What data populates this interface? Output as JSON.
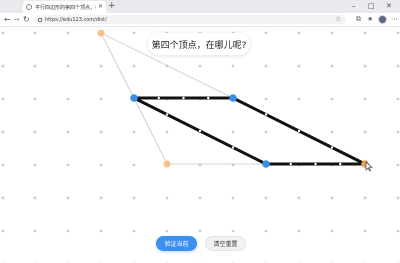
{
  "browser": {
    "tab_title": "平行四边形的第四个顶点，在哪儿？",
    "url": "https://edu123.com/dist/"
  },
  "page": {
    "prompt": "第四个顶点，在哪儿呢?",
    "verify_button": "验证当前",
    "clear_button": "清空重置"
  },
  "colors": {
    "vertex_blue": "#3a8ee6",
    "vertex_orange": "#f5c089",
    "vertex_orange_active": "#e8a25a",
    "primary_button": "#3b8ff0"
  },
  "icons": [
    "favicon-icon",
    "close-icon",
    "new-tab-icon",
    "back-icon",
    "forward-icon",
    "refresh-icon",
    "lock-icon",
    "favorite-icon",
    "collections-icon",
    "profile-avatar",
    "more-icon",
    "minimize-icon",
    "maximize-icon",
    "window-close-icon"
  ]
}
